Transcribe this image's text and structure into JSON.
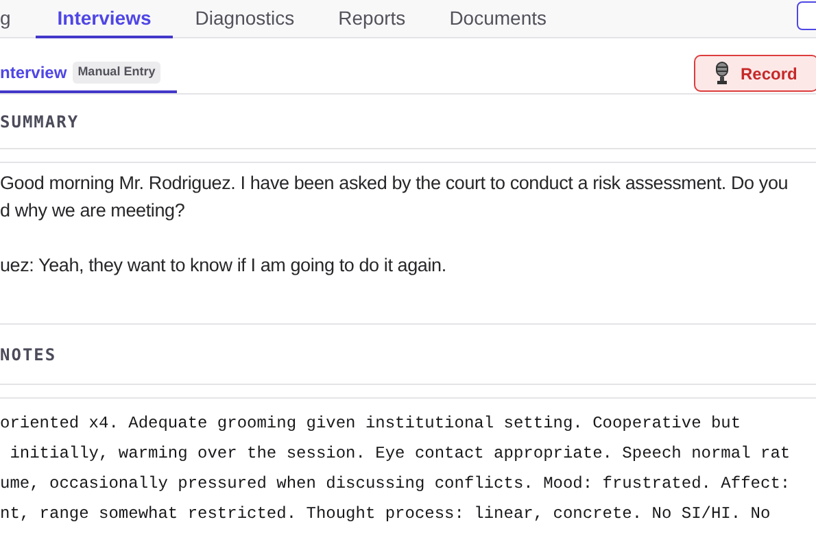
{
  "tabs": [
    {
      "label": "g",
      "selected": false
    },
    {
      "label": "Interviews",
      "selected": true
    },
    {
      "label": "Diagnostics",
      "selected": false
    },
    {
      "label": "Reports",
      "selected": false
    },
    {
      "label": "Documents",
      "selected": false
    }
  ],
  "subtabs": [
    {
      "label": "nterview",
      "badge": "Manual Entry",
      "selected": true
    }
  ],
  "record_button": {
    "label": "Record"
  },
  "summary": {
    "title": "SUMMARY",
    "paragraphs": [
      [
        "Good morning Mr. Rodriguez. I have been asked by the court to conduct a risk assessment. Do you",
        "d why we are meeting?"
      ],
      [
        "uez: Yeah, they want to know if I am going to do it again."
      ]
    ]
  },
  "notes": {
    "title": "NOTES",
    "lines": [
      "oriented x4. Adequate grooming given institutional setting. Cooperative but",
      " initially, warming over the session. Eye contact appropriate. Speech normal rat",
      "ume, occasionally pressured when discussing conflicts. Mood: frustrated. Affect:",
      "nt, range somewhat restricted. Thought process: linear, concrete. No SI/HI. No"
    ]
  }
}
